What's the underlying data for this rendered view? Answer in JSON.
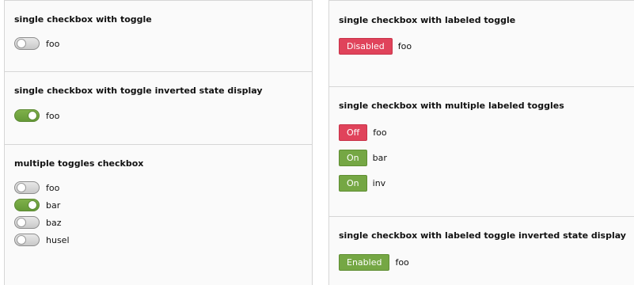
{
  "left": {
    "panel1": {
      "title": "single checkbox with toggle",
      "label": "foo",
      "checked": false
    },
    "panel2": {
      "title": "single checkbox with toggle inverted state display",
      "label": "foo",
      "checked": true
    },
    "panel3": {
      "title": "multiple toggles checkbox",
      "items": [
        {
          "label": "foo",
          "checked": false
        },
        {
          "label": "bar",
          "checked": true
        },
        {
          "label": "baz",
          "checked": false
        },
        {
          "label": "husel",
          "checked": false
        }
      ]
    }
  },
  "right": {
    "panel1": {
      "title": "single checkbox with labeled toggle",
      "button": "Disabled",
      "label": "foo"
    },
    "panel2": {
      "title": "single checkbox with multiple labeled toggles",
      "items": [
        {
          "button": "Off",
          "label": "foo"
        },
        {
          "button": "On",
          "label": "bar"
        },
        {
          "button": "On",
          "label": "inv"
        }
      ]
    },
    "panel3": {
      "title": "single checkbox with labeled toggle inverted state display",
      "button": "Enabled",
      "label": "foo"
    }
  },
  "colors": {
    "on": "#75a744",
    "off_button": "#e0435b",
    "switch_off": "#d4d4d4"
  }
}
